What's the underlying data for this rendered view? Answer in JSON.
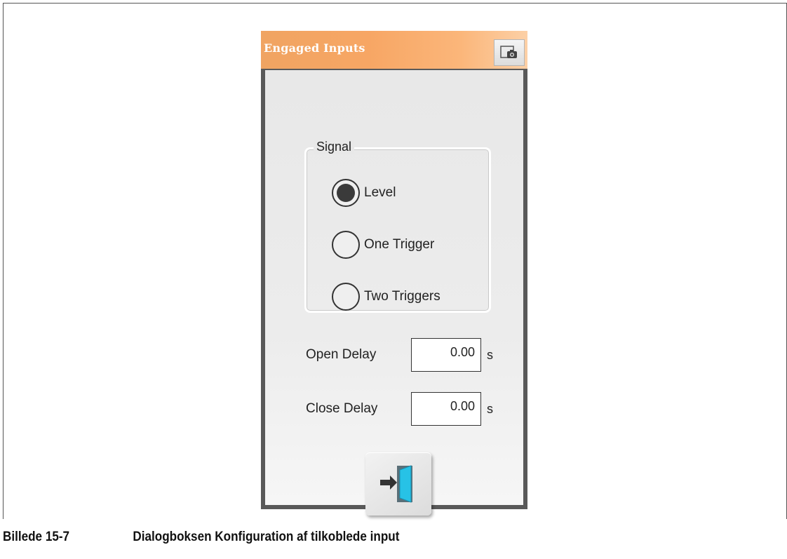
{
  "dialog": {
    "title": "Engaged Inputs",
    "title_color": "#f7a664",
    "camera_icon": "camera-icon",
    "exit_icon": "exit-door-icon"
  },
  "signal": {
    "legend": "Signal",
    "options": [
      {
        "label": "Level",
        "selected": true
      },
      {
        "label": "One Trigger",
        "selected": false
      },
      {
        "label": "Two Triggers",
        "selected": false
      }
    ]
  },
  "fields": {
    "open_delay": {
      "label": "Open Delay",
      "value": "0.00",
      "unit": "s"
    },
    "close_delay": {
      "label": "Close Delay",
      "value": "0.00",
      "unit": "s"
    }
  },
  "caption": {
    "number": "Billede 15-7",
    "text": "Dialogboksen Konfiguration af tilkoblede input"
  }
}
